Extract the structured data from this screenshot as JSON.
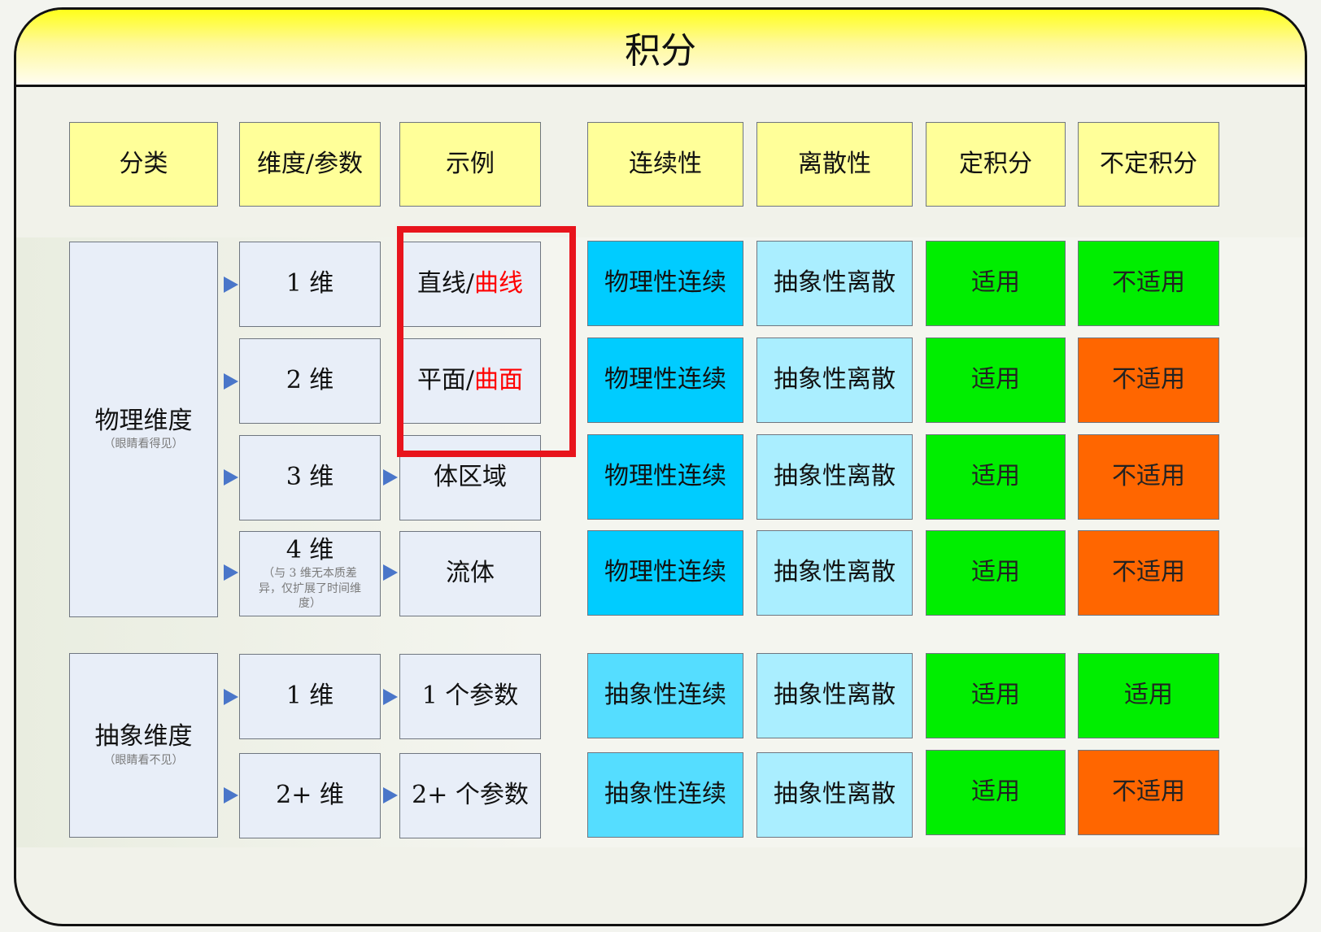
{
  "title": "积分",
  "headers": [
    "分类",
    "维度/参数",
    "示例",
    "连续性",
    "离散性",
    "定积分",
    "不定积分"
  ],
  "categories": [
    {
      "label": "物理维度",
      "note": "（眼睛看得见）"
    },
    {
      "label": "抽象维度",
      "note": "（眼睛看不见）"
    }
  ],
  "rows": [
    {
      "dim": "1 维",
      "dim_note": "",
      "example_a": "直线/",
      "example_b": "曲线",
      "continuity": "物理性连续",
      "discreteness": "抽象性离散",
      "definite": "适用",
      "indefinite": "不适用"
    },
    {
      "dim": "2 维",
      "dim_note": "",
      "example_a": "平面/",
      "example_b": "曲面",
      "continuity": "物理性连续",
      "discreteness": "抽象性离散",
      "definite": "适用",
      "indefinite": "不适用"
    },
    {
      "dim": "3 维",
      "dim_note": "",
      "example_a": "体区域",
      "example_b": "",
      "continuity": "物理性连续",
      "discreteness": "抽象性离散",
      "definite": "适用",
      "indefinite": "不适用"
    },
    {
      "dim": "4 维",
      "dim_note": "（与 3 维无本质差异，仅扩展了时间维度）",
      "example_a": "流体",
      "example_b": "",
      "continuity": "物理性连续",
      "discreteness": "抽象性离散",
      "definite": "适用",
      "indefinite": "不适用"
    },
    {
      "dim": "1 维",
      "dim_note": "",
      "example_a": "1 个参数",
      "example_b": "",
      "continuity": "抽象性连续",
      "discreteness": "抽象性离散",
      "definite": "适用",
      "indefinite": "适用"
    },
    {
      "dim": "2+ 维",
      "dim_note": "",
      "example_a": "2+ 个参数",
      "example_b": "",
      "continuity": "抽象性连续",
      "discreteness": "抽象性离散",
      "definite": "适用",
      "indefinite": "不适用"
    }
  ],
  "colors": {
    "header_fill": "#ffff99",
    "pale_fill": "#e8eef8",
    "physical_continuity": "#00ccff",
    "abstract_continuity": "#55ddff",
    "discreteness": "#aaeeff",
    "applicable": "#00ee00",
    "not_applicable": "#ff6600",
    "highlight": "#e8141c",
    "arrow": "#4a76c9"
  }
}
